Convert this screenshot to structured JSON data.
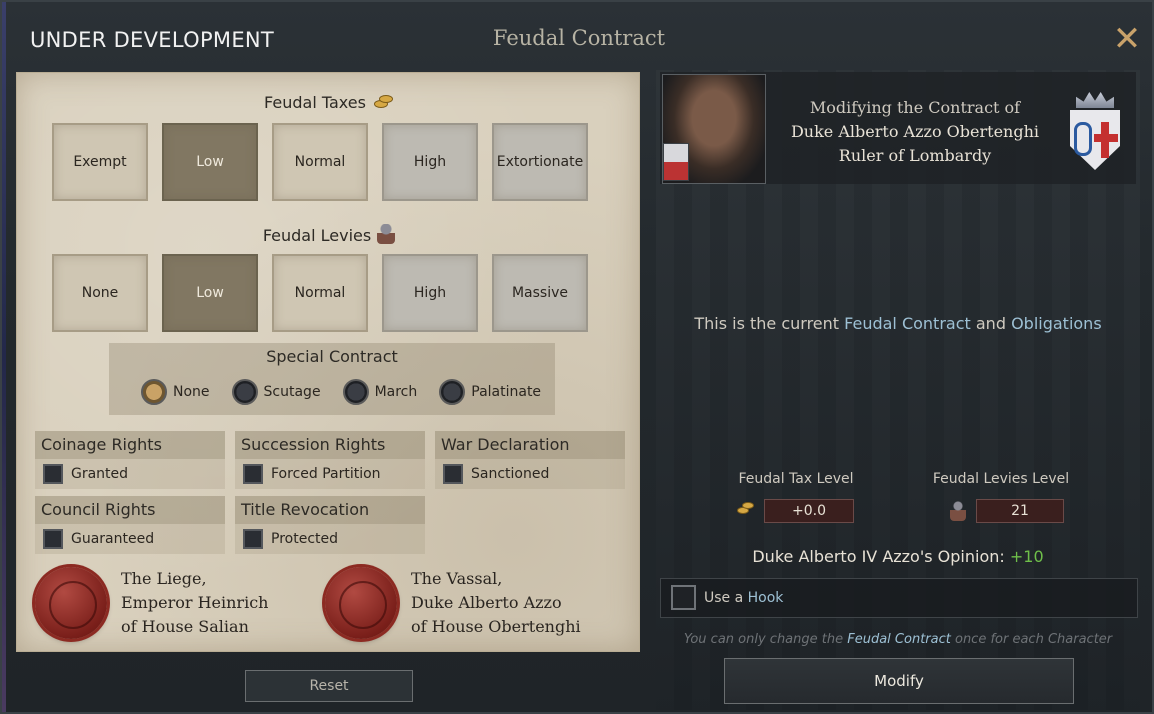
{
  "banner": "UNDER DEVELOPMENT",
  "window_title": "Feudal Contract",
  "close_glyph": "✕",
  "taxes": {
    "title": "Feudal Taxes",
    "options": [
      "Exempt",
      "Low",
      "Normal",
      "High",
      "Extortionate"
    ],
    "selected": "Low"
  },
  "levies": {
    "title": "Feudal Levies",
    "options": [
      "None",
      "Low",
      "Normal",
      "High",
      "Massive"
    ],
    "selected": "Low"
  },
  "special": {
    "title": "Special Contract",
    "options": [
      "None",
      "Scutage",
      "March",
      "Palatinate"
    ],
    "selected": "None"
  },
  "rights": {
    "coinage": {
      "title": "Coinage Rights",
      "item": "Granted"
    },
    "succession": {
      "title": "Succession Rights",
      "item": "Forced Partition"
    },
    "war": {
      "title": "War Declaration",
      "item": "Sanctioned"
    },
    "council": {
      "title": "Council Rights",
      "item": "Guaranteed"
    },
    "revocation": {
      "title": "Title Revocation",
      "item": "Protected"
    }
  },
  "liege": {
    "line1": "The Liege,",
    "line2": "Emperor Heinrich",
    "line3": "of House Salian"
  },
  "vassal": {
    "line1": "The Vassal,",
    "line2": "Duke Alberto Azzo",
    "line3": "of House Obertenghi"
  },
  "reset_label": "Reset",
  "character": {
    "line1": "Modifying the Contract of",
    "line2": "Duke Alberto Azzo Obertenghi",
    "line3": "Ruler of Lombardy"
  },
  "current": {
    "prefix": "This is the current ",
    "link1": "Feudal Contract",
    "mid": " and ",
    "link2": "Obligations"
  },
  "stats": {
    "tax_label": "Feudal Tax Level",
    "tax_value": "+0.0",
    "levies_label": "Feudal Levies Level",
    "levies_value": "21"
  },
  "opinion": {
    "name": "Duke Alberto IV Azzo",
    "suffix": "'s Opinion: ",
    "value": "+10"
  },
  "hook": {
    "prefix": "Use a ",
    "link": "Hook"
  },
  "note": {
    "prefix": "You can only change the ",
    "link": "Feudal Contract",
    "suffix": " once for each Character"
  },
  "modify_label": "Modify",
  "colors": {
    "accent_link": "#9dc0d4",
    "positive": "#6fbf4a",
    "parchment": "#d9d0bd"
  },
  "icons": [
    "coin-icon",
    "soldier-icon",
    "close-icon",
    "seal-icon",
    "coat-of-arms-icon"
  ]
}
